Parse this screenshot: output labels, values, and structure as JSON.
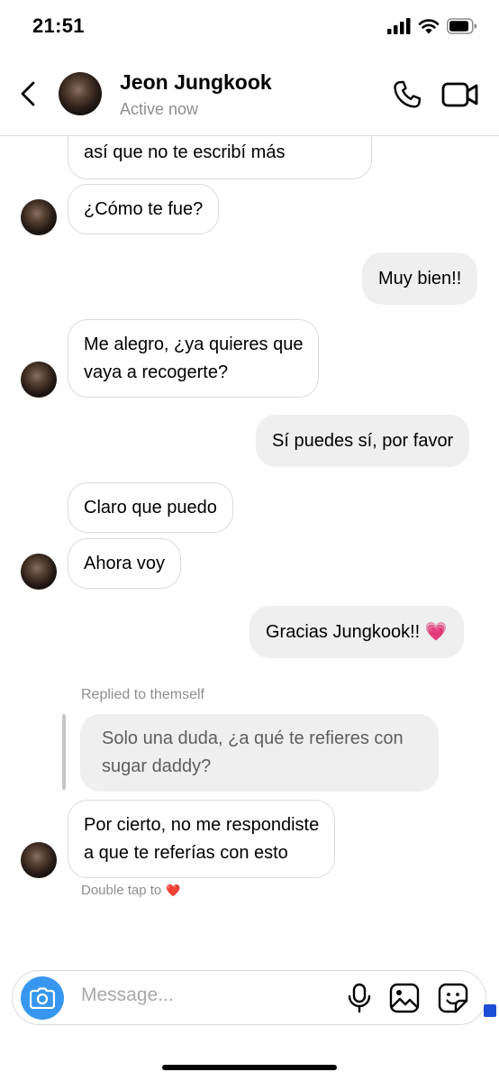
{
  "status_bar": {
    "time": "21:51"
  },
  "header": {
    "contact_name": "Jeon Jungkook",
    "contact_status": "Active now"
  },
  "messages": [
    {
      "from": "them",
      "text": "así que no te escribí más"
    },
    {
      "from": "them",
      "text": "¿Cómo te fue?"
    },
    {
      "from": "me",
      "text": "Muy bien!!"
    },
    {
      "from": "them",
      "lines": [
        "Me alegro, ¿ya quieres que",
        "vaya a recogerte?"
      ]
    },
    {
      "from": "me",
      "text": "Sí puedes sí, por favor"
    },
    {
      "from": "them",
      "text": "Claro que puedo"
    },
    {
      "from": "them",
      "text": "Ahora voy"
    },
    {
      "from": "me",
      "text": "Gracias Jungkook!! 💗"
    },
    {
      "from": "them",
      "reply_label": "Replied to themself",
      "quoted_lines": [
        "Solo una duda, ¿a qué te refieres con",
        "sugar daddy?"
      ],
      "lines": [
        "Por cierto, no me respondiste",
        "a que te referías con esto"
      ]
    }
  ],
  "hint": {
    "text": "Double tap to",
    "heart": "❤️"
  },
  "composer": {
    "placeholder": "Message..."
  },
  "colors": {
    "accent": "#3797f0",
    "outgoing_bubble": "#efefef",
    "border": "#dbdbdb",
    "secondary_text": "#8e8e8e"
  },
  "icons": [
    "back-chevron-icon",
    "phone-icon",
    "video-camera-icon",
    "camera-icon",
    "microphone-icon",
    "image-icon",
    "sticker-icon"
  ]
}
